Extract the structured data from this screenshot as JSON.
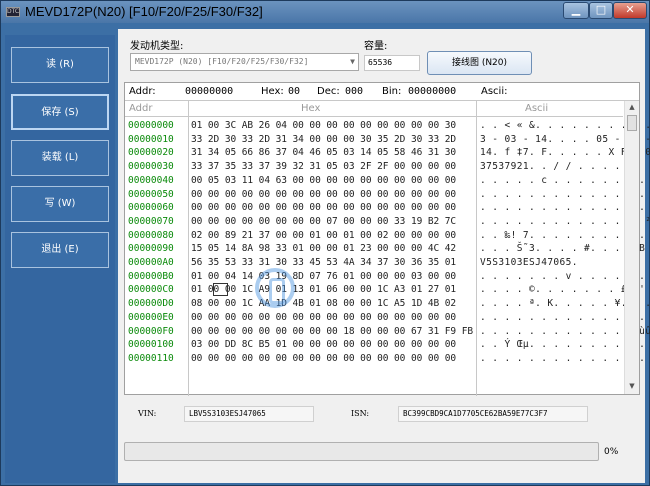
{
  "window": {
    "title": "MEVD172P(N20) [F10/F20/F25/F30/F32]",
    "app_icon_label": "DTC",
    "buttons": {
      "minimize": "▁",
      "maximize": "□",
      "close": "✕"
    }
  },
  "sidebar": {
    "items": [
      {
        "label": "读 (R)"
      },
      {
        "label": "保存 (S)",
        "active": true
      },
      {
        "label": "装载 (L)"
      },
      {
        "label": "写 (W)"
      },
      {
        "label": "退出 (E)"
      }
    ]
  },
  "engine": {
    "type_label": "发动机类型:",
    "type_value": "MEVD172P (N20) [F10/F20/F25/F30/F32]",
    "capacity_label": "容量:",
    "capacity_value": "65536",
    "wiring_button": "接线图 (N20)"
  },
  "hex": {
    "addr_label": "Addr:",
    "addr_value": "00000000",
    "hex_label": "Hex:",
    "hex_value": "00",
    "dec_label": "Dec:",
    "dec_value": "000",
    "bin_label": "Bin:",
    "bin_value": "00000000",
    "ascii_label": "Ascii:",
    "col_addr": "Addr",
    "col_hex": "Hex",
    "col_ascii": "Ascii",
    "rows": [
      {
        "addr": "00000000",
        "hex": "01 00 3C AB 26 04 00 00 00 00 00 00 00 00 00 30",
        "ascii": ". . < « &. . . . . . . . . . 0"
      },
      {
        "addr": "00000010",
        "hex": "33 2D 30 33 2D 31 34 00 00 00 30 35 2D 30 33 2D",
        "ascii": "3 - 03 - 14. . . . 05 - 03 -"
      },
      {
        "addr": "00000020",
        "hex": "31 34 05 66 86 37 04 46 05 03 14 05 58 46 31 30",
        "ascii": "14. f ‡7. F. . . . . X F 1 0"
      },
      {
        "addr": "00000030",
        "hex": "33 37 35 33 37 39 32 31 05 03 2F 2F 00 00 00 00",
        "ascii": "37537921. . / / . . . ."
      },
      {
        "addr": "00000040",
        "hex": "00 05 03 11 04 63 00 00 00 00 00 00 00 00 00 00",
        "ascii": ". . . . . c . . . . . . . . . ."
      },
      {
        "addr": "00000050",
        "hex": "00 00 00 00 00 00 00 00 00 00 00 00 00 00 00 00",
        "ascii": ". . . . . . . . . . . . . . . ."
      },
      {
        "addr": "00000060",
        "hex": "00 00 00 00 00 00 00 00 00 00 00 00 00 00 00 00",
        "ascii": ". . . . . . . . . . . . . . . ."
      },
      {
        "addr": "00000070",
        "hex": "00 00 00 00 00 00 00 00 07 00 00 00 33 19 B2 7C",
        "ascii": ". . . . . . . . . . . . 3. ² |"
      },
      {
        "addr": "00000080",
        "hex": "02 00 89 21 37 00 00 01 00 01 00 02 00 00 00 00",
        "ascii": ". . ‰! 7. . . . . . . . . . ."
      },
      {
        "addr": "00000090",
        "hex": "15 05 14 8A 98 33 01 00 00 01 23 00 00 00 4C 42",
        "ascii": ". . . Š˜3. . . . #. . . L B"
      },
      {
        "addr": "000000A0",
        "hex": "56 35 53 33 31 30 33 45 53 4A 34 37 30 36 35 01",
        "ascii": "V5S3103ESJ47065."
      },
      {
        "addr": "000000B0",
        "hex": "01 00 04 14 03 19 8D 07 76 01 00 00 00 03 00 00",
        "ascii": ". . . . . . . v . . . . . . . ."
      },
      {
        "addr": "000000C0",
        "hex": "01 00 00 1C A9 01 13 01 06 00 00 1C A3 01 27 01",
        "ascii": ". . . . ©. . . . . . . £. ' ."
      },
      {
        "addr": "000000D0",
        "hex": "08 00 00 1C AA 1D 4B 01 08 00 00 1C A5 1D 4B 02",
        "ascii": ". . . . ª. K. . . . . ¥. K ."
      },
      {
        "addr": "000000E0",
        "hex": "00 00 00 00 00 00 00 00 00 00 00 00 00 00 00 00",
        "ascii": ". . . . . . . . . . . . . . . ."
      },
      {
        "addr": "000000F0",
        "hex": "00 00 00 00 00 00 00 00 00 18 00 00 00 67 31 F9 FB",
        "ascii": ". . . . . . . . . . . . g1ùû"
      },
      {
        "addr": "00000100",
        "hex": "03 00 DD 8C B5 01 00 00 00 00 00 00 00 00 00 00",
        "ascii": ". . Ý Œµ. . . . . . . . . . ."
      },
      {
        "addr": "00000110",
        "hex": "00 00 00 00 00 00 00 00 00 00 00 00 00 00 00 00",
        "ascii": ". . . . . . . . . . . . . . . ."
      }
    ]
  },
  "ids": {
    "vin_label": "VIN:",
    "vin_value": "LBV5S3103ESJ47065",
    "isn_label": "ISN:",
    "isn_value": "BC399CBD9CA1D7705CE62BA59E77C3F7"
  },
  "progress": {
    "percent": 0,
    "label": "0%"
  },
  "colors": {
    "accent": "#3466a0",
    "addr_text": "#0a8a0a",
    "progress_fill": "#4aa84a"
  }
}
